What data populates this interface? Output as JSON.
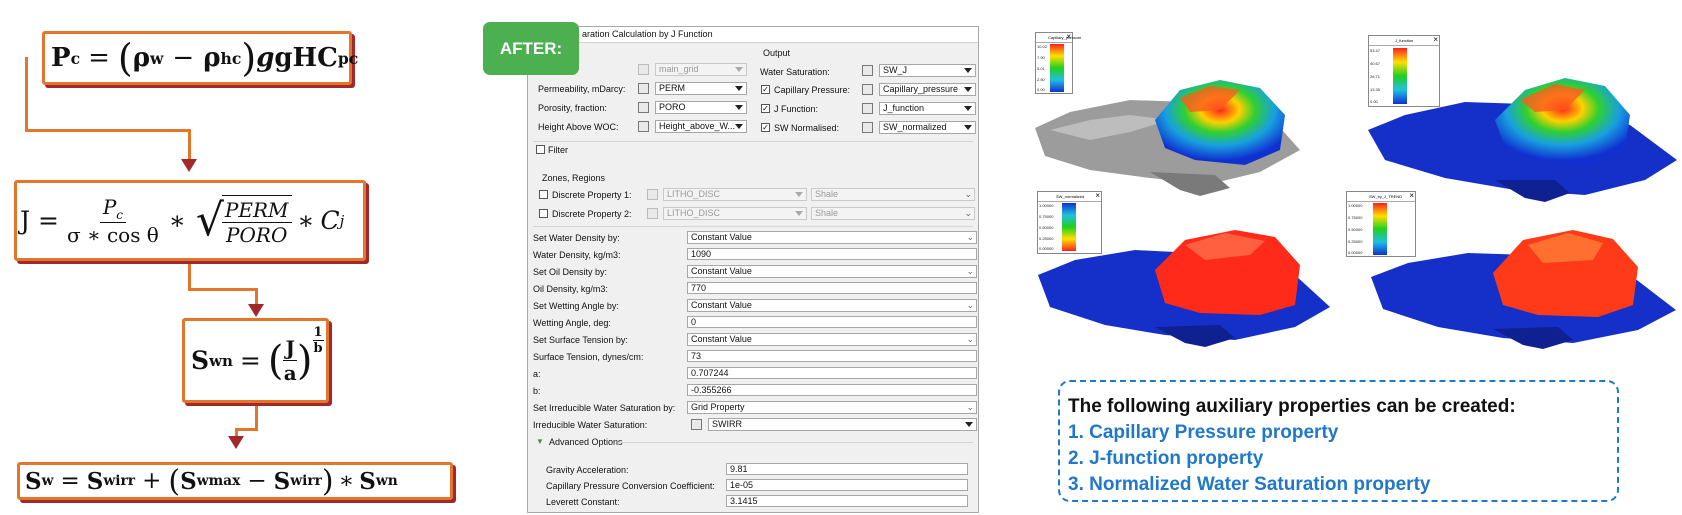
{
  "badge": "AFTER:",
  "formulas": {
    "f1": {
      "lhs": "P",
      "lhs_sub": "c",
      "eq": "=",
      "rho_w": "ρ",
      "w": "w",
      "minus": "−",
      "rho_hc": "ρ",
      "hc": "hc",
      "tail": "gHC",
      "tail_sub": "pc"
    },
    "f2": {
      "lhs": "J",
      "eq": "=",
      "num": "P",
      "num_sub": "c",
      "den": "σ ∗ cos θ",
      "mul1": "∗",
      "rnum": "PERM",
      "rden": "PORO",
      "mul2": "∗",
      "c": "C",
      "c_sub": "j"
    },
    "f3": {
      "lhs": "S",
      "lhs_sub": "wn",
      "eq": "=",
      "j": "J",
      "a": "a",
      "exp_num": "1",
      "exp_den": "b"
    },
    "f4": {
      "lhs": "S",
      "lhs_sub": "w",
      "eq": "=",
      "s1": "S",
      "s1_sub": "wirr",
      "plus": "+",
      "s2": "S",
      "s2_sub": "wmax",
      "minus": "−",
      "s3": "S",
      "s3_sub": "wirr",
      "mul": "∗",
      "s4": "S",
      "s4_sub": "wn"
    }
  },
  "dialog": {
    "title": "aration Calculation by J Function",
    "output_label": "Output",
    "input_rows": [
      {
        "label": "",
        "value": "main_grid"
      },
      {
        "label": "Permeability, mDarcy:",
        "value": "PERM"
      },
      {
        "label": "Porosity, fraction:",
        "value": "PORO"
      },
      {
        "label": "Height Above WOC:",
        "value": "Height_above_W..."
      }
    ],
    "output_rows": [
      {
        "label": "Water Saturation:",
        "value": "SW_J"
      },
      {
        "label": "Capillary Pressure:",
        "value": "Capillary_pressure"
      },
      {
        "label": "J Function:",
        "value": "J_function"
      },
      {
        "label": "SW Normalised:",
        "value": "SW_normalized"
      }
    ],
    "filter_label": "Filter",
    "zones_label": "Zones, Regions",
    "zone_rows": [
      {
        "label": "Discrete Property 1:",
        "value": "LITHO_DISC",
        "value2": "Shale"
      },
      {
        "label": "Discrete Property 2:",
        "value": "LITHO_DISC",
        "value2": "Shale"
      }
    ],
    "param_rows": [
      {
        "label": "Set Water Density by:",
        "value": "Constant Value"
      },
      {
        "label": "Water Density, kg/m3:",
        "value": "1090"
      },
      {
        "label": "Set Oil Density by:",
        "value": "Constant Value"
      },
      {
        "label": "Oil Density, kg/m3:",
        "value": "770"
      },
      {
        "label": "Set Wetting Angle by:",
        "value": "Constant Value"
      },
      {
        "label": "Wetting Angle, deg:",
        "value": "0"
      },
      {
        "label": "Set Surface Tension by:",
        "value": "Constant Value"
      },
      {
        "label": "Surface Tension, dynes/cm:",
        "value": "73"
      },
      {
        "label": "a:",
        "value": "0.707244"
      },
      {
        "label": "b:",
        "value": "-0.355266"
      },
      {
        "label": "Set Irreducible Water Saturation by:",
        "value": "Grid Property"
      },
      {
        "label": "Irreducible Water Saturation:",
        "value": "SWIRR"
      }
    ],
    "advanced_label": "Advanced Options",
    "advanced_rows": [
      {
        "label": "Gravity Acceleration:",
        "value": "9.81"
      },
      {
        "label": "Capillary Pressure Conversion Coefficient:",
        "value": "1e-05"
      },
      {
        "label": "Leverett Constant:",
        "value": "3.1415"
      }
    ]
  },
  "viewers": [
    {
      "legend_title": "Capillary_pressure",
      "ticks": [
        "10.02",
        "7.90",
        "5.01",
        "2.50",
        "0.00"
      ],
      "palette": "rainbow-red-top"
    },
    {
      "legend_title": "J_function",
      "ticks": [
        "53.47",
        "40.67",
        "26.71",
        "13.35",
        "0.00"
      ],
      "palette": "rainbow-red-top"
    },
    {
      "legend_title": "SW_normalized",
      "ticks": [
        "1.00000",
        "0.75000",
        "0.50000",
        "0.25000",
        "0.00000"
      ],
      "palette": "rainbow-blue-top"
    },
    {
      "legend_title": "SW_by_J_TREND",
      "ticks": [
        "1.00000",
        "0.75000",
        "0.50000",
        "0.25000",
        "0.00000"
      ],
      "palette": "rainbow-red-top"
    }
  ],
  "info": {
    "heading": "The following auxiliary properties can be created:",
    "items": [
      "1. Capillary Pressure property",
      "2. J-function property",
      "3. Normalized Water Saturation property"
    ]
  }
}
